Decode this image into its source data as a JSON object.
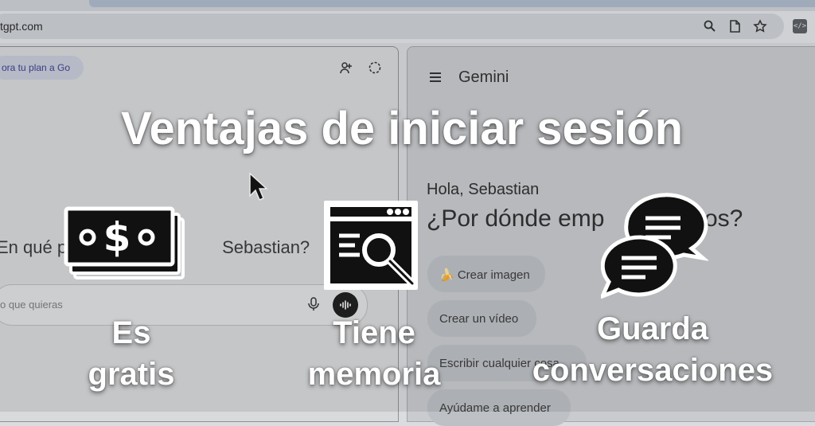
{
  "browser": {
    "url": "tgpt.com",
    "toolbar_icons": [
      "zoom-icon",
      "document-icon",
      "star-icon",
      "extension-icon"
    ],
    "extension_label": "</>"
  },
  "chatgpt": {
    "upgrade_label": "ora tu plan a Go",
    "question_start": "En qué p",
    "question_end": "Sebastian?",
    "composer_placeholder": "o que quieras"
  },
  "gemini": {
    "app_name": "Gemini",
    "greeting": "Hola, Sebastian",
    "headline_start": "¿Por dónde emp",
    "headline_end": "os?",
    "chips": [
      {
        "label": "🍌 Crear imagen"
      },
      {
        "label": "Crear un vídeo"
      },
      {
        "label": "Escribir cualquier cosa"
      },
      {
        "label": "Ayúdame a aprender"
      }
    ]
  },
  "overlay": {
    "title": "Ventajas de iniciar sesión",
    "benefits": [
      {
        "line1": "Es",
        "line2": "gratis",
        "icon": "money-icon"
      },
      {
        "line1": "Tiene",
        "line2": "memoria",
        "icon": "browser-search-icon"
      },
      {
        "line1": "Guarda",
        "line2": "conversaciones",
        "icon": "chat-bubbles-icon"
      }
    ]
  },
  "colors": {
    "overlay_text": "#ffffff",
    "icon_fill": "#111111",
    "chip_bg": "#bdc0c4"
  }
}
